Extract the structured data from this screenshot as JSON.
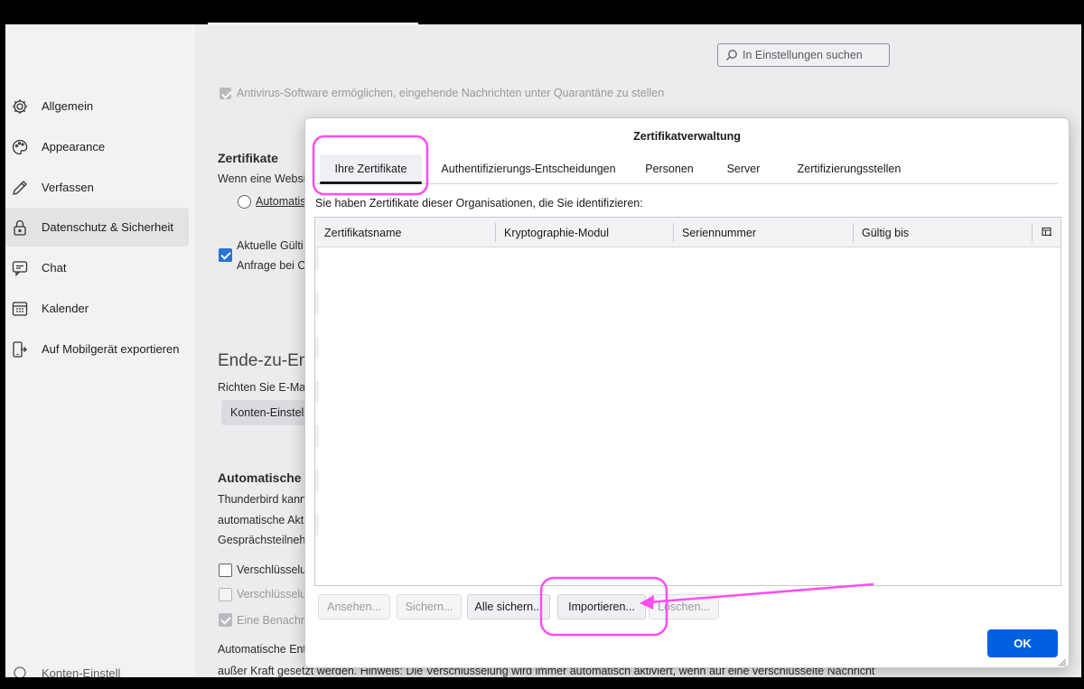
{
  "search": {
    "placeholder": "In Einstellungen suchen"
  },
  "sidebar": {
    "items": [
      {
        "label": "Allgemein",
        "icon": "gear-icon"
      },
      {
        "label": "Appearance",
        "icon": "palette-icon"
      },
      {
        "label": "Verfassen",
        "icon": "pencil-icon"
      },
      {
        "label": "Datenschutz & Sicherheit",
        "icon": "lock-icon"
      },
      {
        "label": "Chat",
        "icon": "chat-icon"
      },
      {
        "label": "Kalender",
        "icon": "calendar-icon"
      },
      {
        "label": "Auf Mobilgerät exportieren",
        "icon": "mobile-export-icon"
      }
    ],
    "bottom_partial": "Konten-Einstell"
  },
  "background": {
    "antivirus": "Antivirus-Software ermöglichen, eingehende Nachrichten unter Quarantäne zu stellen",
    "certs_heading": "Zertifikate",
    "certs_text": "Wenn eine Websi",
    "automatic_radio": "Automatis",
    "current_validity_line1": "Aktuelle Gülti",
    "current_validity_line2": "Anfrage bei O",
    "e2e_heading": "Ende-zu-End",
    "e2e_text": "Richten Sie E-Mai",
    "account_settings_btn": "Konten-Einstel",
    "auto_heading": "Automatische V",
    "auto_line1": "Thunderbird kann",
    "auto_line2": "automatische Akt",
    "auto_line3": "Gesprächsteilnehr",
    "cb1": "Verschlüsselur",
    "cb2": "Verschlüsselur",
    "cb3": "Eine Benachri",
    "bottom_line1": "Automatische Ent",
    "bottom_line2": "außer Kraft gesetzt werden. Hinweis: Die Verschlüsselung wird immer automatisch aktiviert, wenn auf eine verschlüsselte Nachricht"
  },
  "dialog": {
    "title": "Zertifikatverwaltung",
    "tabs": [
      "Ihre Zertifikate",
      "Authentifizierungs-Entscheidungen",
      "Personen",
      "Server",
      "Zertifizierungsstellen"
    ],
    "description": "Sie haben Zertifikate dieser Organisationen, die Sie identifizieren:",
    "columns": [
      "Zertifikatsname",
      "Kryptographie-Modul",
      "Seriennummer",
      "Gültig bis"
    ],
    "buttons": {
      "view": "Ansehen...",
      "backup": "Sichern...",
      "backup_all": "Alle sichern...",
      "import": "Importieren...",
      "delete": "Löschen...",
      "ok": "OK"
    }
  },
  "colors": {
    "accent": "#0061e0",
    "annotation": "#ff4df0"
  }
}
